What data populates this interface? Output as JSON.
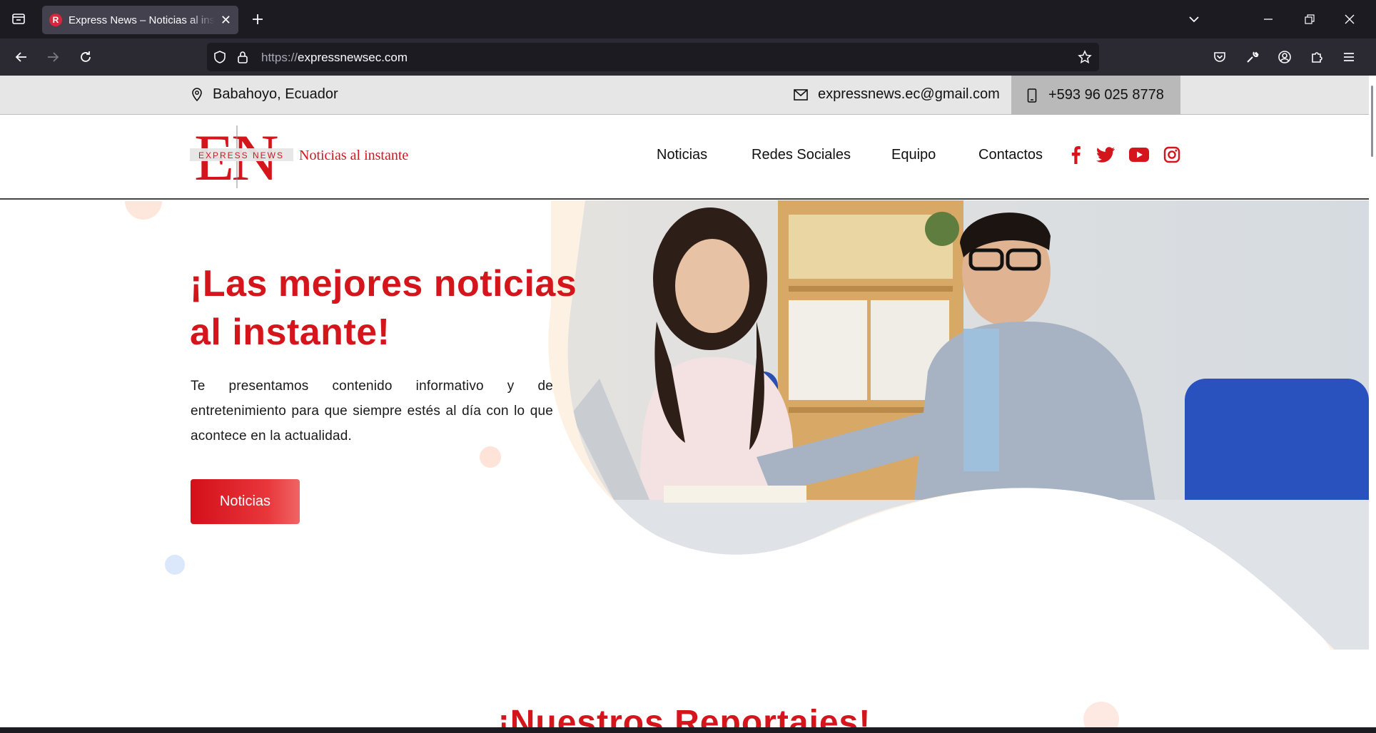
{
  "browser": {
    "tab_title": "Express News – Noticias al instante",
    "tab_favicon_letter": "R",
    "url_protocol": "https://",
    "url_host": "expressnewsec.com"
  },
  "topbar": {
    "location": "Babahoyo, Ecuador",
    "email": "expressnews.ec@gmail.com",
    "phone": "+593 96 025 8778"
  },
  "logo": {
    "letters": "EN",
    "brand": "EXPRESS NEWS",
    "tagline": "Noticias al instante"
  },
  "menu": [
    "Noticias",
    "Redes Sociales",
    "Equipo",
    "Contactos"
  ],
  "social": [
    "facebook-icon",
    "twitter-icon",
    "youtube-icon",
    "instagram-icon"
  ],
  "hero": {
    "title": "¡Las mejores noticias al instante!",
    "description": "Te presentamos contenido informativo y de entretenimiento para que siempre estés al día con lo que acontece en la actualidad.",
    "button": "Noticias"
  },
  "section": {
    "title": "¡Nuestros Reportajes!"
  },
  "colors": {
    "brand_red": "#d4161c",
    "topbar_bg": "#e6e6e6",
    "chrome_bg": "#1c1b22",
    "toolbar_bg": "#2b2a33"
  }
}
